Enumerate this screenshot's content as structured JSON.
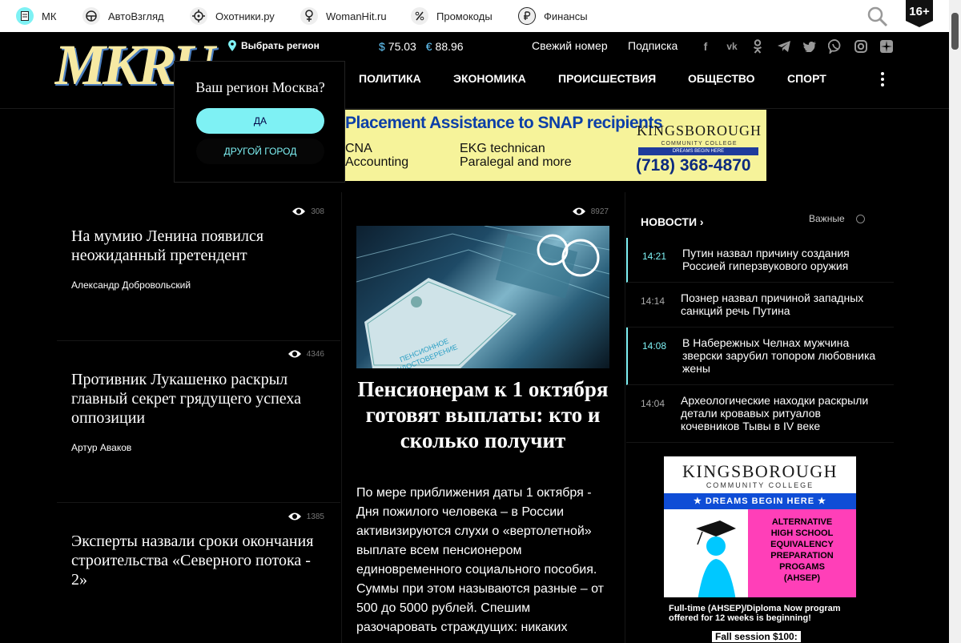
{
  "partners": [
    {
      "label": "МК",
      "icon": "mk-doc-icon"
    },
    {
      "label": "АвтоВзгляд",
      "icon": "steering-wheel-icon"
    },
    {
      "label": "Охотники.ру",
      "icon": "target-icon"
    },
    {
      "label": "WomanHit.ru",
      "icon": "female-symbol-icon"
    },
    {
      "label": "Промокоды",
      "icon": "percent-icon"
    },
    {
      "label": "Финансы",
      "icon": "ruble-icon"
    }
  ],
  "age_rating": "16+",
  "header": {
    "logo_text": "MKRU",
    "region_label": "Выбрать регион",
    "rates": {
      "usd_symbol": "$",
      "usd": "75.03",
      "eur_symbol": "€",
      "eur": "88.96"
    },
    "links": [
      "Свежий номер",
      "Подписка"
    ],
    "social": [
      "facebook-icon",
      "vk-icon",
      "odnoklassniki-icon",
      "telegram-icon",
      "twitter-icon",
      "viber-icon",
      "instagram-icon",
      "zen-icon"
    ],
    "nav": [
      "ПОЛИТИКА",
      "ЭКОНОМИКА",
      "ПРОИСШЕСТВИЯ",
      "ОБЩЕСТВО",
      "СПОРТ"
    ]
  },
  "region_popup": {
    "question": "Ваш регион Москва?",
    "yes": "ДА",
    "other": "ДРУГОЙ ГОРОД"
  },
  "banner": {
    "headline": "Placement Assistance to SNAP recipients",
    "line1a": "CNA",
    "line1b": "EKG technican",
    "line2a": "Accounting",
    "line2b": "Paralegal and more",
    "brand": "KINGSBOROUGH",
    "brand_sub": "COMMUNITY COLLEGE",
    "tagline": "DREAMS BEGIN HERE",
    "phone": "(718) 368-4870"
  },
  "left_articles": [
    {
      "views": "308",
      "title": "На мумию Ленина появился неожиданный претендент",
      "author": "Александр Добровольский"
    },
    {
      "views": "4346",
      "title": "Противник Лукашенко раскрыл главный секрет грядущего успеха оппозиции",
      "author": "Артур Аваков"
    },
    {
      "views": "1385",
      "title": "Эксперты назвали сроки окончания строительства «Северного потока - 2»",
      "author": ""
    }
  ],
  "feature": {
    "views": "8927",
    "photo_caption": "ПЕНСИОННОЕ УДОСТОВЕРЕНИЕ",
    "title": "Пенсионерам к 1 октября готовят выплаты: кто и сколько получит",
    "text": "По мере приближения даты 1 октября - Дня пожилого человека – в России активизируются слухи о «вертолетной» выплате всем пенсионером единовременного социального пособия. Суммы при этом называются разные – от 500 до 5000 рублей. Спешим разочаровать страждущих: никаких"
  },
  "news": {
    "heading": "НОВОСТИ",
    "important": "Важные",
    "items": [
      {
        "time": "14:21",
        "text": "Путин назвал причину создания Россией гиперзвукового оружия",
        "highlight": true
      },
      {
        "time": "14:14",
        "text": "Познер назвал причиной западных санкций речь Путина",
        "highlight": false
      },
      {
        "time": "14:08",
        "text": "В Набережных Челнах мужчина зверски зарубил топором любовника жены",
        "highlight": true
      },
      {
        "time": "14:04",
        "text": "Археологические находки раскрыли детали кровавых ритуалов кочевников Тывы в IV веке",
        "highlight": false
      }
    ]
  },
  "side_ad": {
    "brand": "KINGSBOROUGH",
    "brand_sub": "COMMUNITY COLLEGE",
    "band": "★ DREAMS BEGIN HERE ★",
    "lines": [
      "ALTERNATIVE",
      "HIGH SCHOOL",
      "EQUIVALENCY",
      "PREPARATION",
      "PROGAMS",
      "(AHSEP)"
    ],
    "bottom1": "Full-time (AHSEP)/Diploma Now program",
    "bottom2": "offered for 12 weeks is beginning!",
    "bottom3": "Fall session $100:"
  },
  "colors": {
    "accent": "#7ef1f4",
    "background": "#000000"
  }
}
